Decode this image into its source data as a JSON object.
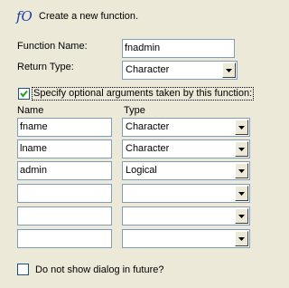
{
  "header": {
    "title": "Create a new function."
  },
  "function_name": {
    "label": "Function Name:",
    "value": "fnadmin"
  },
  "return_type": {
    "label": "Return Type:",
    "value": "Character"
  },
  "optional_args": {
    "label": "Specify optional arguments taken by this function:",
    "checked": true
  },
  "columns": {
    "name": "Name",
    "type": "Type"
  },
  "arguments": [
    {
      "name": "fname",
      "type": "Character"
    },
    {
      "name": "lname",
      "type": "Character"
    },
    {
      "name": "admin",
      "type": "Logical"
    },
    {
      "name": "",
      "type": ""
    },
    {
      "name": "",
      "type": ""
    },
    {
      "name": "",
      "type": ""
    }
  ],
  "footer": {
    "do_not_show_label": "Do not show dialog in future?",
    "checked": false
  }
}
